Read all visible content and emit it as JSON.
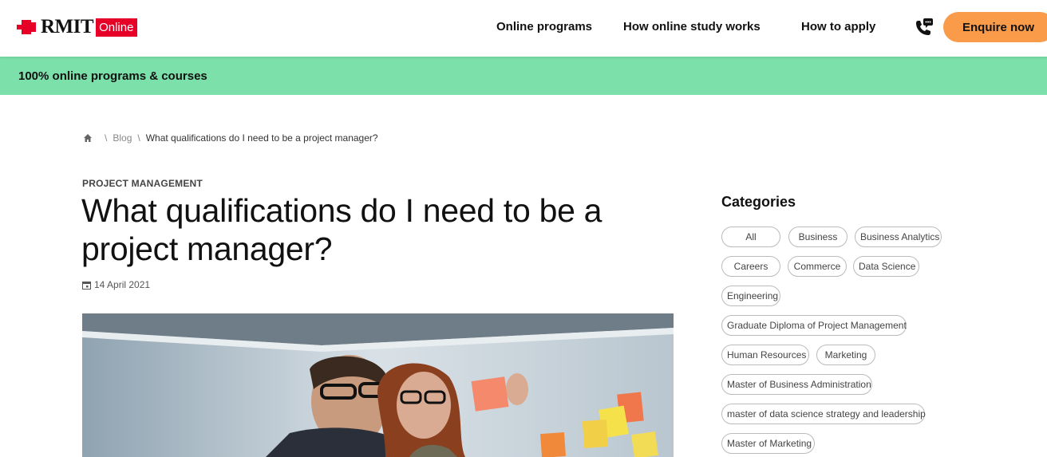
{
  "header": {
    "logo_text": "RMIT",
    "logo_badge": "Online",
    "nav": [
      "Online programs",
      "How online study works",
      "How to apply"
    ],
    "enquire_label": "Enquire now"
  },
  "banner": {
    "text": "100% online programs & courses"
  },
  "breadcrumb": {
    "home_icon": "home-icon",
    "blog": "Blog",
    "current": "What qualifications do I need to be a project manager?"
  },
  "article": {
    "topic": "PROJECT MANAGEMENT",
    "title_line1": "What qualifications do I need to be a",
    "title_line2": "project manager?",
    "date": "14 April 2021"
  },
  "sidebar": {
    "title": "Categories",
    "tags": [
      "All",
      "Business",
      "Business Analytics",
      "Careers",
      "Commerce",
      "Data Science",
      "Engineering",
      "Graduate Diploma of Project Management",
      "Human Resources",
      "Marketing",
      "Master of Business Administration",
      "master of data science strategy and leadership",
      "Master of Marketing"
    ]
  },
  "colors": {
    "accent": "#fa9b4a",
    "banner": "#7be0a9",
    "brand_red": "#e60028"
  }
}
